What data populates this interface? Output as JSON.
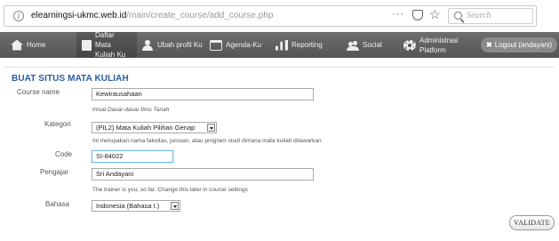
{
  "browser": {
    "url_host": "elearningsi-ukmc.web.id",
    "url_path": "/main/create_course/add_course.php",
    "more_glyph": "···",
    "search_placeholder": "Search"
  },
  "nav": {
    "items": [
      {
        "label": "Home",
        "icon": "home-icon"
      },
      {
        "label": "Daftar Mata Kuliah Ku",
        "icon": "document-icon"
      },
      {
        "label": "Ubah profil Ku",
        "icon": "user-icon"
      },
      {
        "label": "Agenda-Ku",
        "icon": "calendar-icon"
      },
      {
        "label": "Reporting",
        "icon": "bar-chart-icon"
      },
      {
        "label": "Social",
        "icon": "people-icon"
      },
      {
        "label": "Administrasi Platform",
        "icon": "gear-icon"
      }
    ],
    "logout_label": "Logout (andayani)"
  },
  "form": {
    "title": "BUAT SITUS MATA KULIAH",
    "course_name": {
      "label": "Course name",
      "value": "Kewirausahaan",
      "hint_prefix": "misal ",
      "hint_example": "Dasar-dasar Ilmu Tanah"
    },
    "kategori": {
      "label": "Kategori",
      "value": "(PIL2) Mata Kuliah Pilihan Genap",
      "hint": "Ini merupakan nama fakultas, jurusan, atau program studi dimana mata kuliah ditawarkan"
    },
    "code": {
      "label": "Code",
      "value": "SI-84022"
    },
    "pengajar": {
      "label": "Pengajar",
      "value": "Sri Andayani",
      "hint": "The trainer is you, so far. Change this later in course settings"
    },
    "bahasa": {
      "label": "Bahasa",
      "value": "Indonesia (Bahasa I.)"
    },
    "validate_label": "VALIDATE"
  }
}
